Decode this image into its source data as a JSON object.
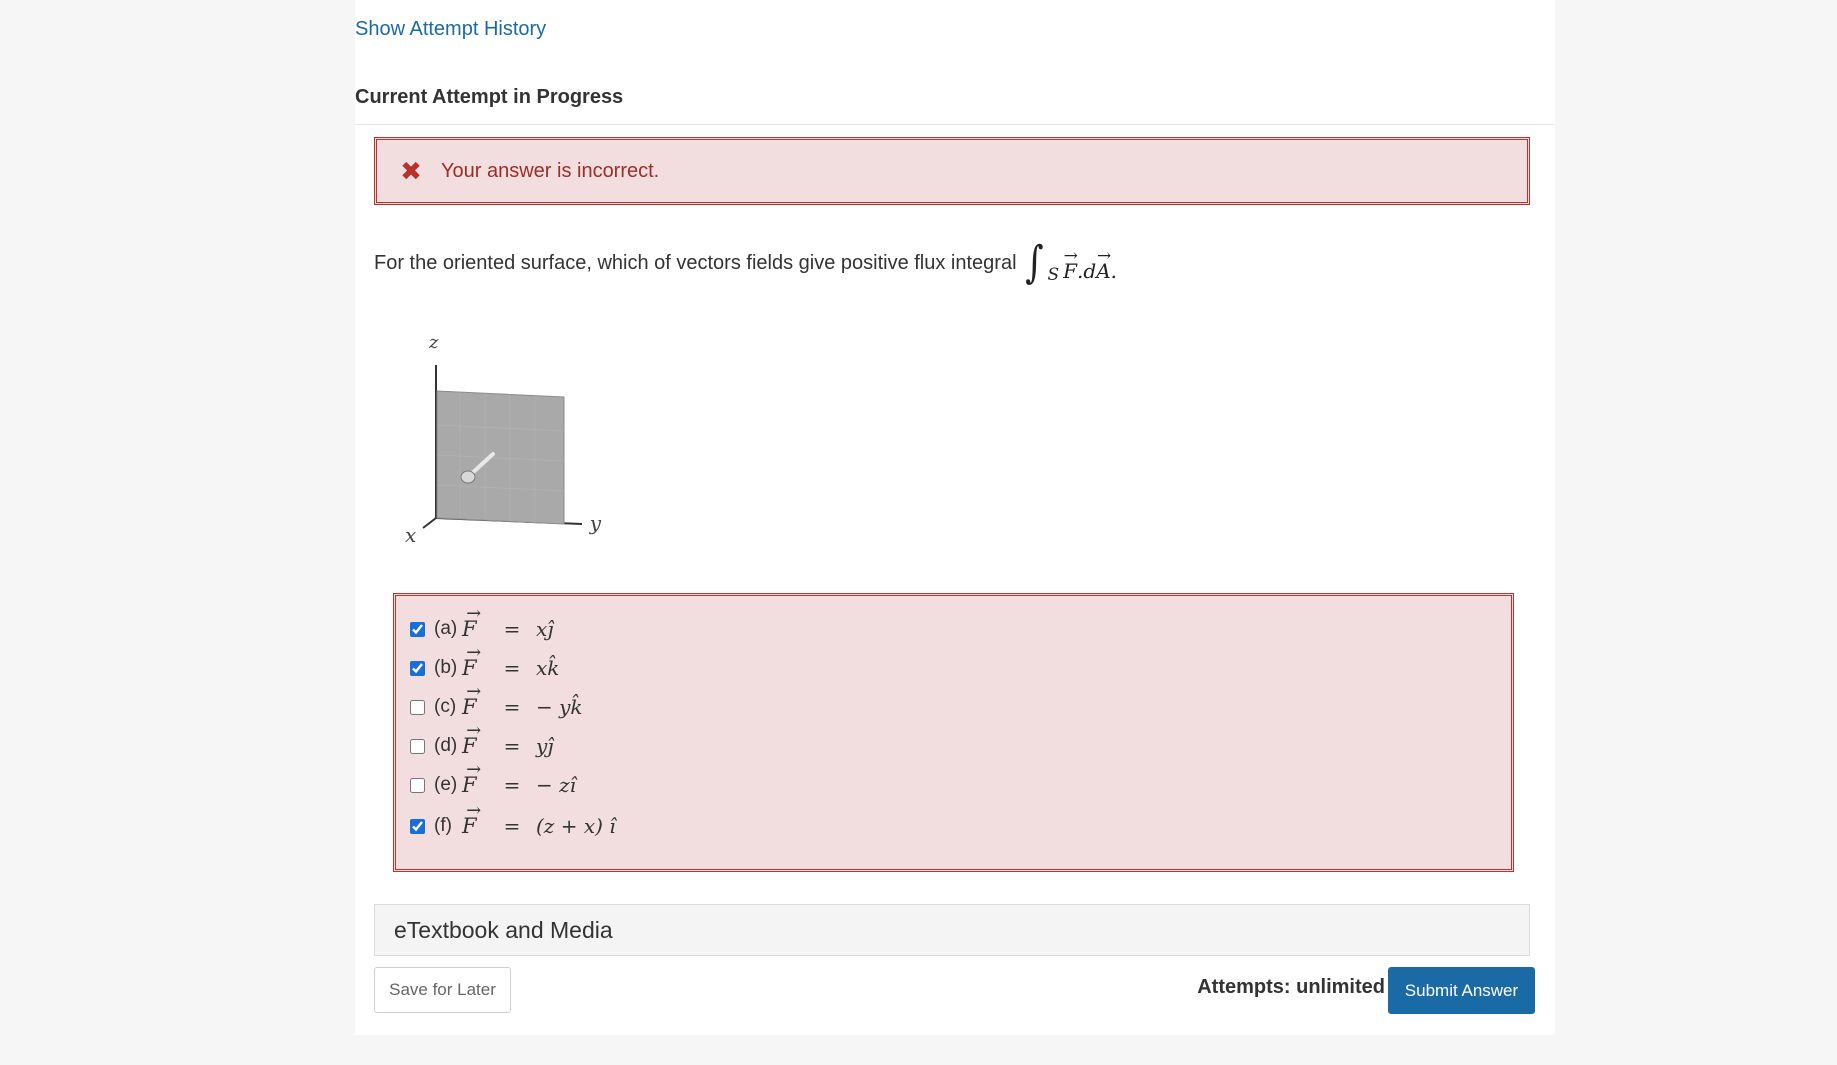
{
  "nav": {
    "history_link": "Show Attempt History"
  },
  "attempt": {
    "title": "Current Attempt in Progress"
  },
  "feedback": {
    "message": "Your answer is incorrect.",
    "icon": "x-mark-icon",
    "color": "#b8322d"
  },
  "question": {
    "text": "For the oriented surface, which of vectors fields give positive flux integral",
    "integral_symbol": "∫",
    "integral_subscript": "S",
    "integral_F": "F",
    "integral_dot_d": ".d",
    "integral_A": "A",
    "integral_end": "."
  },
  "figure": {
    "z_label": "z",
    "x_label": "x",
    "y_label": "y"
  },
  "options": [
    {
      "letter": "(a)",
      "F": "F",
      "eq": "=",
      "rhs": "xĵ",
      "checked": true
    },
    {
      "letter": "(b)",
      "F": "F",
      "eq": "=",
      "rhs": "xk̂",
      "checked": true
    },
    {
      "letter": "(c)",
      "F": "F",
      "eq": "=",
      "rhs": "− yk̂",
      "checked": false
    },
    {
      "letter": "(d)",
      "F": "F",
      "eq": "=",
      "rhs": "yĵ",
      "checked": false
    },
    {
      "letter": "(e)",
      "F": "F",
      "eq": "=",
      "rhs": "− zî",
      "checked": false
    },
    {
      "letter": "(f)",
      "F": "F",
      "eq": "=",
      "rhs": "(z  + x) î",
      "checked": true
    }
  ],
  "etextbook": {
    "label": "eTextbook and Media"
  },
  "footer": {
    "save_label": "Save for Later",
    "attempts_label": "Attempts: unlimited",
    "submit_label": "Submit Answer"
  },
  "colors": {
    "link": "#1a6aa6",
    "error_border": "#b8322d",
    "error_bg": "#f3dedf",
    "submit_bg": "#1a6aa6"
  }
}
